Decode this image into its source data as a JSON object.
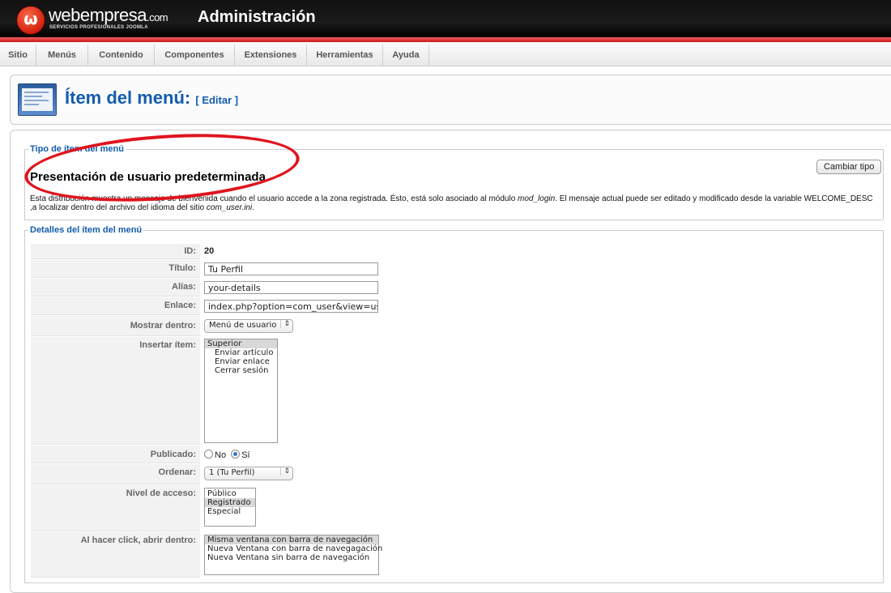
{
  "header": {
    "logo_text": "webempresa",
    "logo_domain": ".com",
    "logo_tagline": "SERVICIOS PROFESIONALES JOOMLA",
    "admin_title": "Administración"
  },
  "menu": [
    "Sitio",
    "Menús",
    "Contenido",
    "Componentes",
    "Extensiones",
    "Herramientas",
    "Ayuda"
  ],
  "page": {
    "title": "Ítem del menú:",
    "subtitle": "[ Editar ]"
  },
  "type_section": {
    "legend": "Tipo de ítem del menú",
    "name": "Presentación de usuario predeterminada",
    "change_button": "Cambiar tipo",
    "desc_1": "Esta distribución muestra un mensaje de bienvenida cuando el usuario accede a la zona registrada. Ésto, está solo asociado al módulo ",
    "desc_mod": "mod_login",
    "desc_2": ". El mensaje actual puede ser editado y modificado desde la variable WELCOME_DESC ,a localizar dentro del archivo del idioma del sitio ",
    "desc_file": "com_user.ini",
    "desc_3": "."
  },
  "details": {
    "legend": "Detalles del ítem del menú",
    "id_label": "ID:",
    "id_value": "20",
    "title_label": "Título:",
    "title_value": "Tu Perfil",
    "alias_label": "Alías:",
    "alias_value": "your-details",
    "link_label": "Enlace:",
    "link_value": "index.php?option=com_user&view=user&task",
    "show_in_label": "Mostrar dentro:",
    "show_in_value": "Menú de usuario",
    "insert_label": "Insertar ítem:",
    "insert_items": [
      "Superior",
      "Enviar artículo",
      "Enviar enlace",
      "Cerrar sesión"
    ],
    "published_label": "Publicado:",
    "published_no": "No",
    "published_yes": "Sí",
    "order_label": "Ordenar:",
    "order_value": "1 (Tu Perfil)",
    "access_label": "Nivel de acceso:",
    "access_items": [
      "Público",
      "Registrado",
      "Especial"
    ],
    "click_label": "Al hacer click, abrir dentro:",
    "click_items": [
      "Misma ventana con barra de navegación",
      "Nueva Ventana con barra de navegagación",
      "Nueva Ventana sin barra de navegación"
    ]
  },
  "colors": {
    "header_bg": "#111111",
    "accent_red": "#d0200f",
    "title_blue": "#135cae",
    "annotation_red": "#e0141e"
  }
}
